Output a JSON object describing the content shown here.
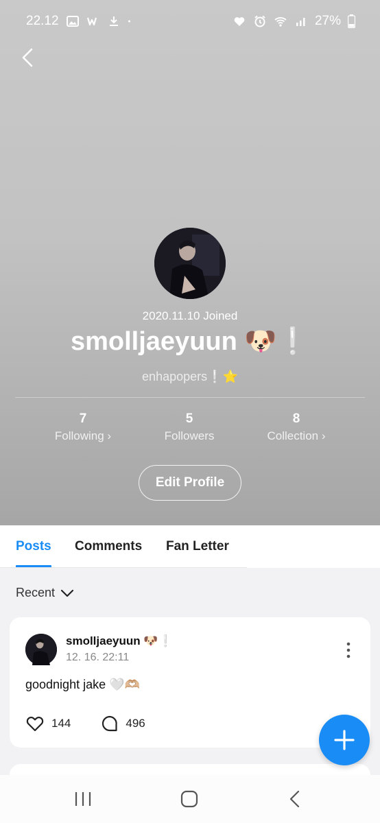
{
  "status_bar": {
    "time": "22.12",
    "battery": "27%",
    "icons_left": [
      "gallery-icon",
      "weverse-icon",
      "download-icon",
      "dot-icon"
    ],
    "icons_right": [
      "heart-icon",
      "alarm-icon",
      "wifi-icon",
      "signal-icon",
      "battery-icon"
    ]
  },
  "profile": {
    "joined": "2020.11.10 Joined",
    "username": "smolljaeyuun 🐶❕",
    "community": "enhapopers❕⭐",
    "stats": [
      {
        "value": "7",
        "label": "Following ›"
      },
      {
        "value": "5",
        "label": "Followers"
      },
      {
        "value": "8",
        "label": "Collection ›"
      }
    ],
    "edit_button": "Edit Profile"
  },
  "tabs": {
    "items": [
      "Posts",
      "Comments",
      "Fan Letter"
    ],
    "active": "Posts"
  },
  "sort": {
    "label": "Recent"
  },
  "posts": [
    {
      "author": "smolljaeyuun 🐶❕",
      "time": "12. 16. 22:11",
      "text": "goodnight jake 🤍🫶🏼",
      "likes": "144",
      "comments": "496"
    }
  ],
  "colors": {
    "accent": "#1a8cf5",
    "hero_top": "#c9c9c9",
    "hero_bottom": "#a6a6a6"
  }
}
